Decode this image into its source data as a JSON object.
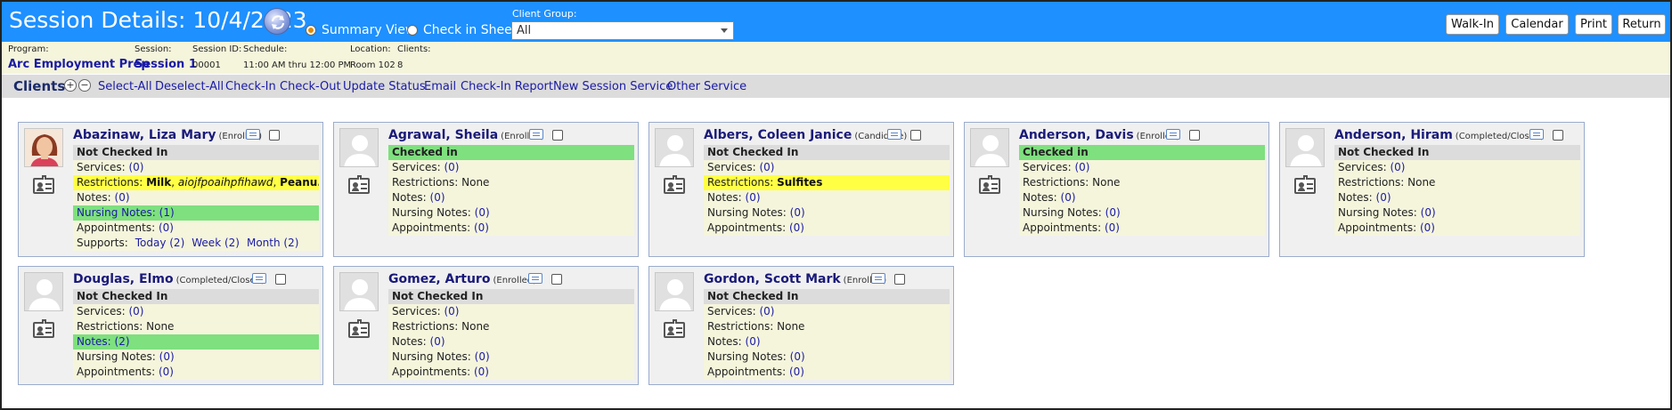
{
  "header": {
    "title": "Session Details: 10/4/2023",
    "view_options": [
      {
        "label": "Summary View",
        "checked": true
      },
      {
        "label": "Check in Sheet",
        "checked": false
      }
    ],
    "client_group_label": "Client Group:",
    "client_group_value": "All",
    "buttons": [
      "Walk-In",
      "Calendar",
      "Print",
      "Return"
    ],
    "colors": {
      "header_bg": "#1e90ff",
      "infobar_bg": "#f5f5dc",
      "checked_in": "#7ee07e",
      "restriction": "#ffff44"
    }
  },
  "info": {
    "program_label": "Program:",
    "program": "Arc Employment Prep",
    "session_label": "Session:",
    "session": "Session 1",
    "session_id_label": "Session ID:",
    "session_id": "00001",
    "schedule_label": "Schedule:",
    "schedule": "11:00 AM thru 12:00 PM",
    "location_label": "Location:",
    "location": "Room 102",
    "clients_label": "Clients:",
    "clients": "8"
  },
  "clients_bar": {
    "title": "Clients",
    "expand_icon": "+",
    "collapse_icon": "−",
    "actions": [
      "Select-All",
      "Deselect-All",
      "Check-In",
      "Check-Out",
      "Update Status",
      "Email",
      "Check-In Report",
      "New Session Service",
      "Other Service"
    ]
  },
  "labels": {
    "services": "Services:",
    "restrictions": "Restrictions:",
    "notes": "Notes:",
    "nursing_notes": "Nursing Notes:",
    "appointments": "Appointments:",
    "supports": "Supports:"
  },
  "cards": [
    {
      "name": "Abazinaw, Liza Mary",
      "status": "(Enrolled)",
      "checkin": "Not Checked In",
      "services": "(0)",
      "restrictions_items": [
        "Milk",
        "aiojfpoaihpfihawd",
        "Peanu..."
      ],
      "notes": "(0)",
      "nursing_notes": "Nursing Notes: (1)",
      "appointments": "(0)",
      "supports": [
        "Today (2)",
        "Week (2)",
        "Month (2)"
      ]
    },
    {
      "name": "Agrawal, Sheila",
      "status": "(Enrolled)",
      "checkin": "Checked in",
      "services": "(0)",
      "restrictions": "None",
      "notes": "(0)",
      "nursing_notes": "(0)",
      "appointments": "(0)"
    },
    {
      "name": "Albers, Coleen Janice",
      "status": "(Candidate)",
      "checkin": "Not Checked In",
      "services": "(0)",
      "restrictions": "Sulfites",
      "notes": "(0)",
      "nursing_notes": "(0)",
      "appointments": "(0)"
    },
    {
      "name": "Anderson, Davis",
      "status": "(Enrolled)",
      "checkin": "Checked in",
      "services": "(0)",
      "restrictions": "None",
      "notes": "(0)",
      "nursing_notes": "(0)",
      "appointments": "(0)"
    },
    {
      "name": "Anderson, Hiram",
      "status": "(Completed/Closed)",
      "checkin": "Not Checked In",
      "services": "(0)",
      "restrictions": "None",
      "notes": "(0)",
      "nursing_notes": "(0)",
      "appointments": "(0)"
    },
    {
      "name": "Douglas, Elmo",
      "status": "(Completed/Closed)",
      "checkin": "Not Checked In",
      "services": "(0)",
      "restrictions": "None",
      "notes": "Notes: (2)",
      "nursing_notes": "(0)",
      "appointments": "(0)"
    },
    {
      "name": "Gomez, Arturo",
      "status": "(Enrolled)",
      "checkin": "Not Checked In",
      "services": "(0)",
      "restrictions": "None",
      "notes": "(0)",
      "nursing_notes": "(0)",
      "appointments": "(0)"
    },
    {
      "name": "Gordon, Scott Mark",
      "status": "(Enrolled)",
      "checkin": "Not Checked In",
      "services": "(0)",
      "restrictions": "None",
      "notes": "(0)",
      "nursing_notes": "(0)",
      "appointments": "(0)"
    }
  ]
}
